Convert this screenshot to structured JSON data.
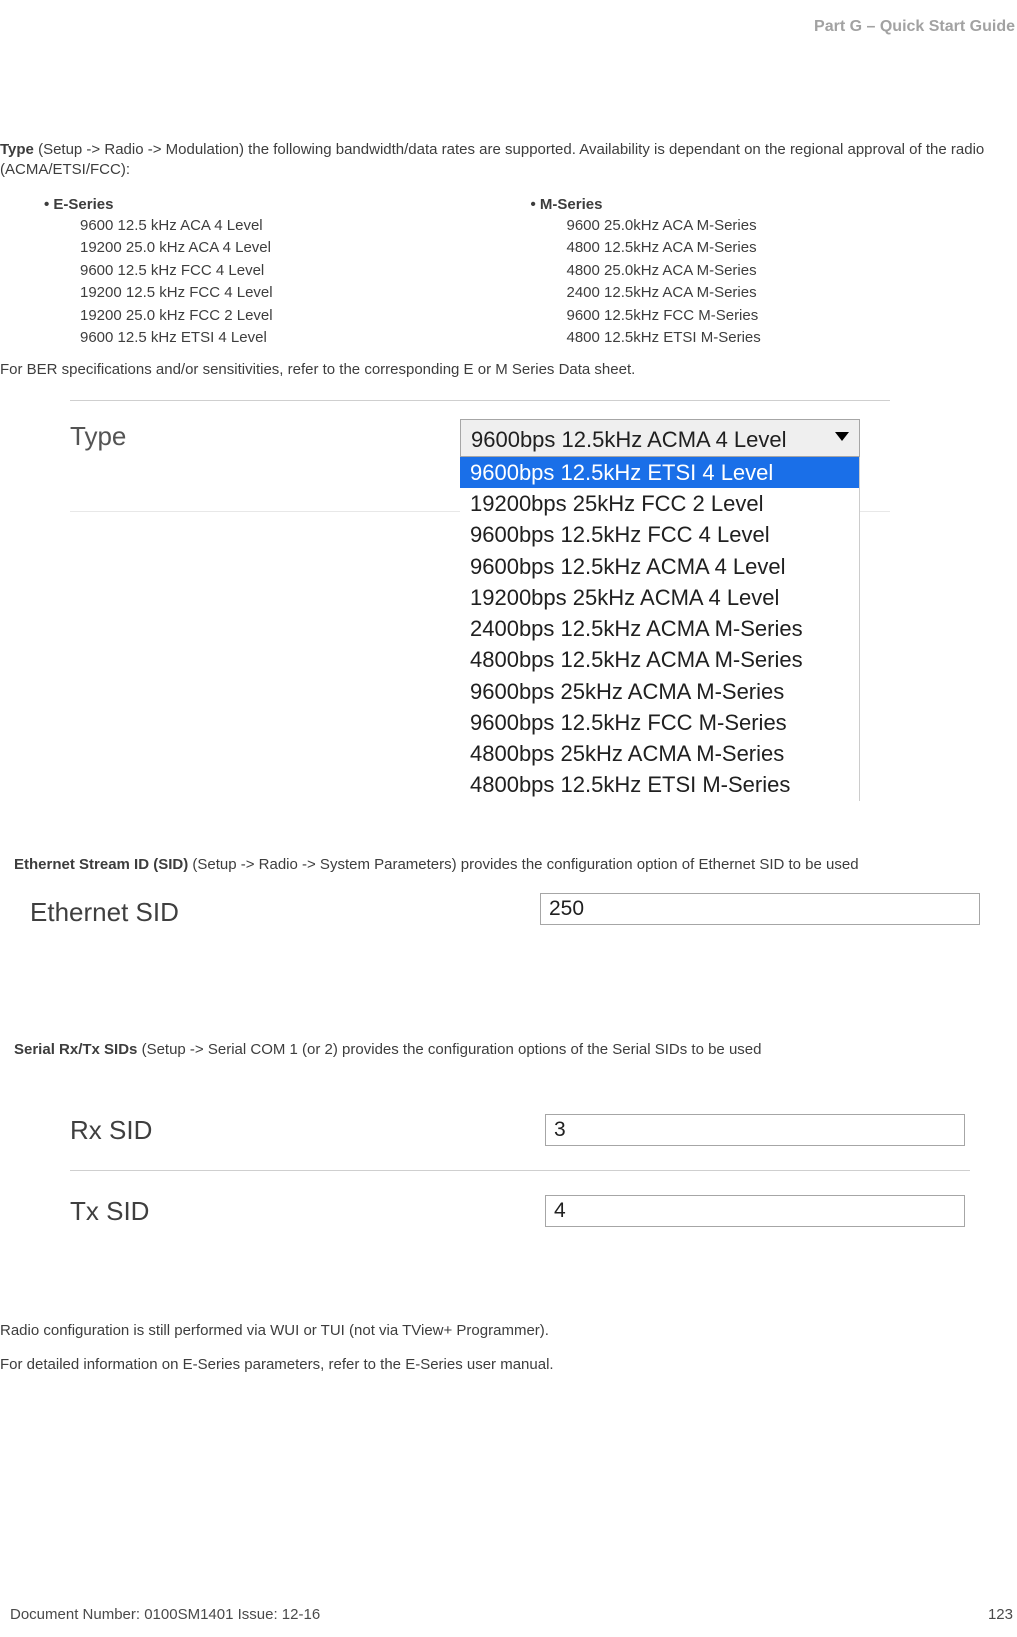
{
  "header": {
    "part_title": "Part G – Quick Start Guide"
  },
  "type_section": {
    "label_bold": "Type",
    "intro_rest": " (Setup -> Radio -> Modulation) the following bandwidth/data rates are supported. Availability is dependant on the regional approval of the radio (ACMA/ETSI/FCC):",
    "e_series_head": "E-Series",
    "e_series_items": [
      "9600 12.5 kHz ACA 4 Level",
      "19200 25.0 kHz ACA 4 Level",
      "9600 12.5 kHz FCC 4 Level",
      "19200 12.5 kHz FCC 4 Level",
      "19200 25.0 kHz FCC 2 Level",
      "9600 12.5 kHz ETSI 4 Level"
    ],
    "m_series_head": "M-Series",
    "m_series_items": [
      "9600 25.0kHz ACA M-Series",
      "4800 12.5kHz ACA M-Series",
      "4800 25.0kHz ACA M-Series",
      "2400 12.5kHz ACA M-Series",
      "9600 12.5kHz FCC M-Series",
      "4800 12.5kHz ETSI M-Series"
    ],
    "ber_note": "For BER specifications and/or sensitivities, refer to the corresponding E or M Series Data sheet."
  },
  "type_figure": {
    "label": "Type",
    "selected_display": "9600bps 12.5kHz ACMA 4 Level",
    "highlighted_option": "9600bps 12.5kHz ETSI 4 Level",
    "options_below": [
      "19200bps 25kHz FCC 2 Level",
      "9600bps 12.5kHz FCC 4 Level",
      "9600bps 12.5kHz ACMA 4 Level",
      "19200bps 25kHz ACMA 4 Level",
      "2400bps 12.5kHz ACMA M-Series",
      "4800bps 12.5kHz ACMA M-Series",
      "9600bps 25kHz ACMA M-Series",
      "9600bps 12.5kHz FCC M-Series",
      "4800bps 25kHz ACMA M-Series",
      "4800bps 12.5kHz ETSI M-Series"
    ]
  },
  "eth_section": {
    "label_bold": "Ethernet Stream ID (SID)",
    "rest": " (Setup -> Radio -> System Parameters) provides the configuration option of Ethernet SID to be used",
    "fig_label": "Ethernet SID",
    "fig_value": "250"
  },
  "serial_section": {
    "label_bold": "Serial Rx/Tx SIDs",
    "rest": " (Setup -> Serial COM 1 (or 2) provides the configuration options of the Serial SIDs to be used",
    "rx_label": "Rx SID",
    "rx_value": "3",
    "tx_label": "Tx SID",
    "tx_value": "4"
  },
  "trailing": {
    "p1": "Radio configuration is still performed via WUI or TUI (not via TView+ Programmer).",
    "p2": "For detailed information on E-Series parameters, refer to the E-Series user manual."
  },
  "footer": {
    "left": "Document Number: 0100SM1401   Issue: 12-16",
    "right": "123"
  }
}
